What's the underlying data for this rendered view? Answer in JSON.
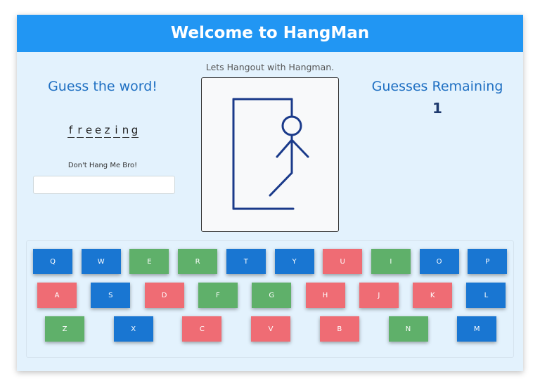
{
  "header": {
    "title": "Welcome to HangMan"
  },
  "tagline": "Lets Hangout with Hangman.",
  "guess": {
    "title": "Guess the word!",
    "letters": [
      "f",
      "r",
      "e",
      "e",
      "z",
      "i",
      "n",
      "g"
    ],
    "hint": "Don't Hang Me Bro!",
    "input_value": ""
  },
  "remaining": {
    "title": "Guesses Remaining",
    "count": "1"
  },
  "colors": {
    "header": "#2196f3",
    "blue": "#1976d2",
    "green": "#5fb06a",
    "red": "#ef6c74",
    "background": "#e3f2fd"
  },
  "keyboard": {
    "rows": [
      [
        {
          "label": "Q",
          "state": "blue"
        },
        {
          "label": "W",
          "state": "blue"
        },
        {
          "label": "E",
          "state": "green"
        },
        {
          "label": "R",
          "state": "green"
        },
        {
          "label": "T",
          "state": "blue"
        },
        {
          "label": "Y",
          "state": "blue"
        },
        {
          "label": "U",
          "state": "red"
        },
        {
          "label": "I",
          "state": "green"
        },
        {
          "label": "O",
          "state": "blue"
        },
        {
          "label": "P",
          "state": "blue"
        }
      ],
      [
        {
          "label": "A",
          "state": "red"
        },
        {
          "label": "S",
          "state": "blue"
        },
        {
          "label": "D",
          "state": "red"
        },
        {
          "label": "F",
          "state": "green"
        },
        {
          "label": "G",
          "state": "green"
        },
        {
          "label": "H",
          "state": "red"
        },
        {
          "label": "J",
          "state": "red"
        },
        {
          "label": "K",
          "state": "red"
        },
        {
          "label": "L",
          "state": "blue"
        }
      ],
      [
        {
          "label": "Z",
          "state": "green"
        },
        {
          "label": "X",
          "state": "blue"
        },
        {
          "label": "C",
          "state": "red"
        },
        {
          "label": "V",
          "state": "red"
        },
        {
          "label": "B",
          "state": "red"
        },
        {
          "label": "N",
          "state": "green"
        },
        {
          "label": "M",
          "state": "blue"
        }
      ]
    ]
  }
}
